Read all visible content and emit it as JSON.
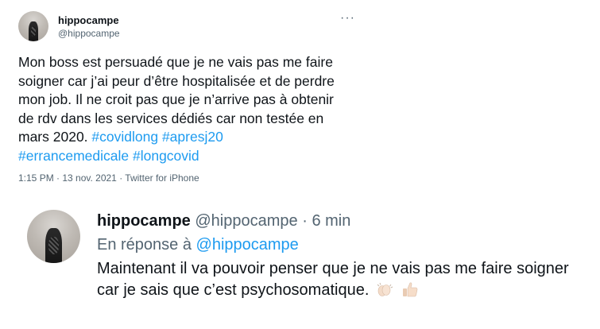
{
  "tweet": {
    "display_name": "hippocampe",
    "handle": "@hippocampe",
    "more_icon": "···",
    "text_plain": "Mon boss est persuadé que je ne vais pas me faire soigner car j’ai peur d’être hospitalisée et de perdre mon job. Il ne croit pas que je n’arrive pas à obtenir de rdv dans les services dédiés car non testée en mars 2020. ",
    "hashtags": [
      "#covidlong",
      "#apresj20",
      "#errancemedicale",
      "#longcovid"
    ],
    "meta": "1:15 PM · 13 nov. 2021 · Twitter for iPhone"
  },
  "reply": {
    "display_name": "hippocampe",
    "handle": "@hippocampe",
    "separator": "·",
    "time": "6 min",
    "in_reply_prefix": "En réponse à ",
    "in_reply_handle": "@hippocampe",
    "text": "Maintenant il va pouvoir penser que je ne vais pas me faire soigner car je sais que c’est psychosomatique.",
    "emojis": [
      "clapping-hands-emoji",
      "thumbs-up-emoji"
    ]
  },
  "colors": {
    "link": "#1d9bf0",
    "muted": "#536471",
    "text": "#0f1419"
  }
}
